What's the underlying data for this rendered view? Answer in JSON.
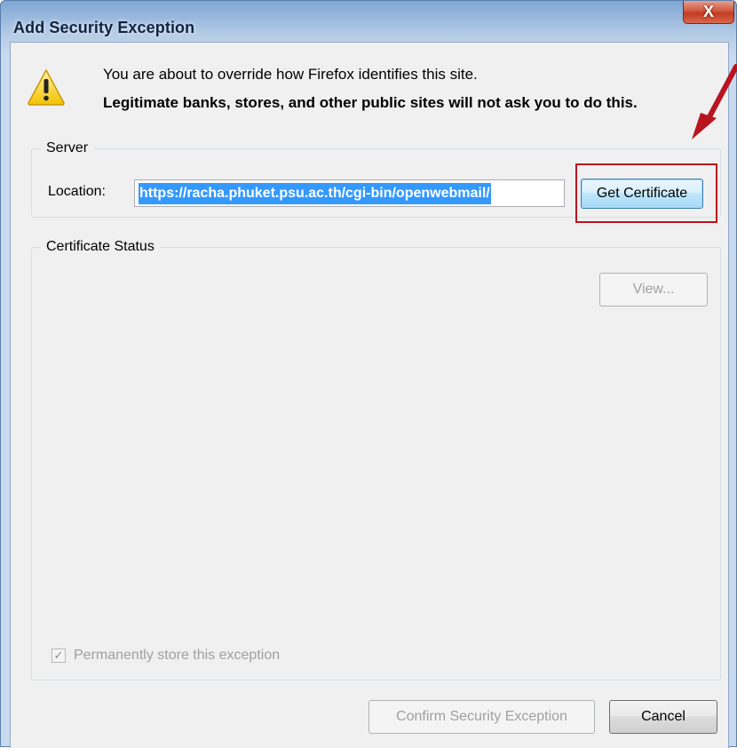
{
  "window": {
    "title": "Add Security Exception",
    "close_glyph": "X"
  },
  "message": {
    "line1": "You are about to override how Firefox identifies this site.",
    "line2": "Legitimate banks, stores, and other public sites will not ask you to do this."
  },
  "server": {
    "legend": "Server",
    "location_label": "Location:",
    "location_value": "https://racha.phuket.psu.ac.th/cgi-bin/openwebmail/",
    "get_certificate_label": "Get Certificate"
  },
  "certificate_status": {
    "legend": "Certificate Status",
    "view_label": "View..."
  },
  "permanent": {
    "label": "Permanently store this exception",
    "checked": true
  },
  "buttons": {
    "confirm_label": "Confirm Security Exception",
    "cancel_label": "Cancel"
  },
  "icons": [
    "warning-icon",
    "close-icon",
    "checkmark-icon",
    "annotation-arrow-icon"
  ],
  "colors": {
    "title_gradient_top": "#7fa6d4",
    "dialog_bg": "#f0f0f0",
    "selection_bg": "#3399ff",
    "close_button": "#c23b22",
    "annotation_red": "#b8141f"
  }
}
